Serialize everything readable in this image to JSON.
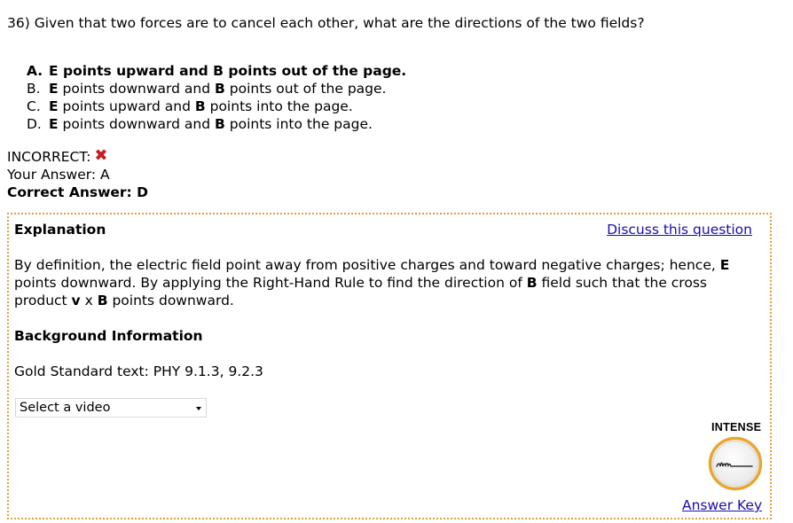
{
  "question": {
    "text": "36) Given that two forces are to cancel each other, what are the directions of the two fields?"
  },
  "choices": [
    {
      "letter": "A.",
      "parts": [
        "E",
        " points upward and ",
        "B",
        " points out of the page."
      ],
      "selected": true
    },
    {
      "letter": "B.",
      "parts": [
        "E",
        " points downward and ",
        "B",
        " points out of the page."
      ],
      "selected": false
    },
    {
      "letter": "C.",
      "parts": [
        "E",
        " points upward and ",
        "B",
        " points into the page."
      ],
      "selected": false
    },
    {
      "letter": "D.",
      "parts": [
        "E",
        " points downward and ",
        "B",
        " points into the page."
      ],
      "selected": false
    }
  ],
  "result": {
    "status_label": "INCORRECT:",
    "status_icon": "x-mark-icon",
    "status_color": "#cc1a1a",
    "your_answer": "Your Answer: A",
    "correct_answer": "Correct Answer: D"
  },
  "explanation_panel": {
    "title": "Explanation",
    "discuss_link": "Discuss this question",
    "body": {
      "p1": "By definition, the electric field point away from positive charges and toward negative charges; hence, ",
      "b1": "E",
      "p2": " points downward. By applying the Right-Hand Rule to find the direction of ",
      "b2": "B",
      "p3": " field such that the cross product ",
      "b3": "v",
      "p4": " x ",
      "b4": "B",
      "p5": " points downward."
    },
    "background_title": "Background Information",
    "gold_standard_text": "Gold Standard text: PHY 9.1.3, 9.2.3",
    "video_select": {
      "selected": "Select a video"
    },
    "intense_label": "INTENSE",
    "intense_icon": "intensity-gauge-icon",
    "answer_key_link": "Answer Key"
  },
  "colors": {
    "link": "#1a0dab",
    "panel_border": "#e0a040",
    "badge_ring": "#e8a830"
  }
}
